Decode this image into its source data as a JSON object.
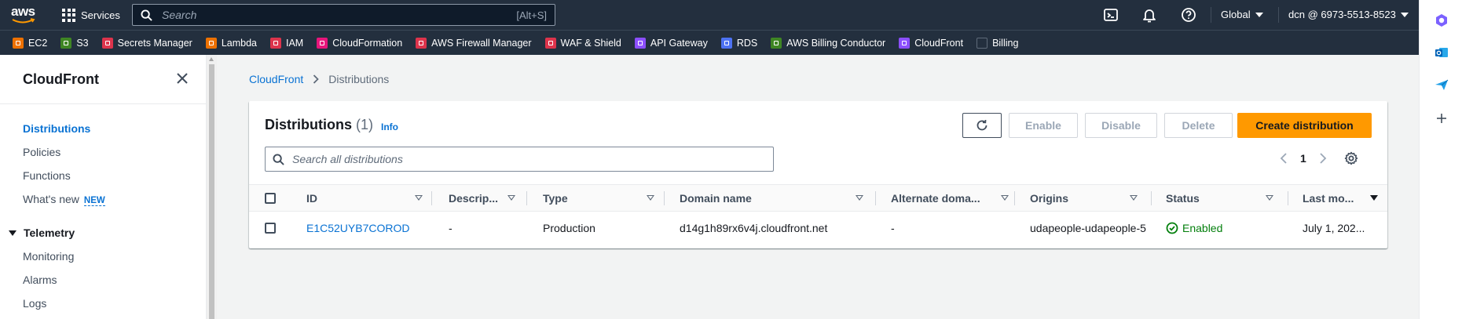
{
  "topbar": {
    "logo": "aws",
    "services_label": "Services",
    "search_placeholder": "Search",
    "search_shortcut": "[Alt+S]",
    "region_label": "Global",
    "account_label": "dcn @ 6973-5513-8523"
  },
  "favorites": [
    {
      "label": "EC2",
      "color": "#ed7100"
    },
    {
      "label": "S3",
      "color": "#3f8624"
    },
    {
      "label": "Secrets Manager",
      "color": "#dd344c"
    },
    {
      "label": "Lambda",
      "color": "#ed7100"
    },
    {
      "label": "IAM",
      "color": "#dd344c"
    },
    {
      "label": "CloudFormation",
      "color": "#e7157b"
    },
    {
      "label": "AWS Firewall Manager",
      "color": "#dd344c"
    },
    {
      "label": "WAF & Shield",
      "color": "#dd344c"
    },
    {
      "label": "API Gateway",
      "color": "#8c4fff"
    },
    {
      "label": "RDS",
      "color": "#4d72f3"
    },
    {
      "label": "AWS Billing Conductor",
      "color": "#3f8624"
    },
    {
      "label": "CloudFront",
      "color": "#8c4fff"
    },
    {
      "label": "Billing",
      "color": "#232f3e"
    }
  ],
  "sidenav": {
    "title": "CloudFront",
    "items": [
      {
        "label": "Distributions",
        "active": true
      },
      {
        "label": "Policies"
      },
      {
        "label": "Functions"
      },
      {
        "label": "What's new",
        "badge": "NEW"
      }
    ],
    "section": {
      "label": "Telemetry",
      "items": [
        {
          "label": "Monitoring"
        },
        {
          "label": "Alarms"
        },
        {
          "label": "Logs"
        }
      ]
    }
  },
  "breadcrumb": {
    "root": "CloudFront",
    "current": "Distributions"
  },
  "panel": {
    "title": "Distributions",
    "count": "(1)",
    "info": "Info",
    "buttons": {
      "enable": "Enable",
      "disable": "Disable",
      "delete": "Delete",
      "create": "Create distribution"
    },
    "search_placeholder": "Search all distributions",
    "page": "1"
  },
  "table": {
    "columns": [
      "ID",
      "Descrip...",
      "Type",
      "Domain name",
      "Alternate doma...",
      "Origins",
      "Status",
      "Last mo..."
    ],
    "rows": [
      {
        "id": "E1C52UYB7COROD",
        "description": "-",
        "type": "Production",
        "domain": "d14g1h89rx6v4j.cloudfront.net",
        "alternate": "-",
        "origins": "udapeople-udapeople-5",
        "status": "Enabled",
        "last_modified": "July 1, 202..."
      }
    ]
  },
  "colors": {
    "nav_bg": "#232f3e",
    "link": "#0972d3",
    "primary": "#ff9900",
    "success": "#037f0c"
  }
}
